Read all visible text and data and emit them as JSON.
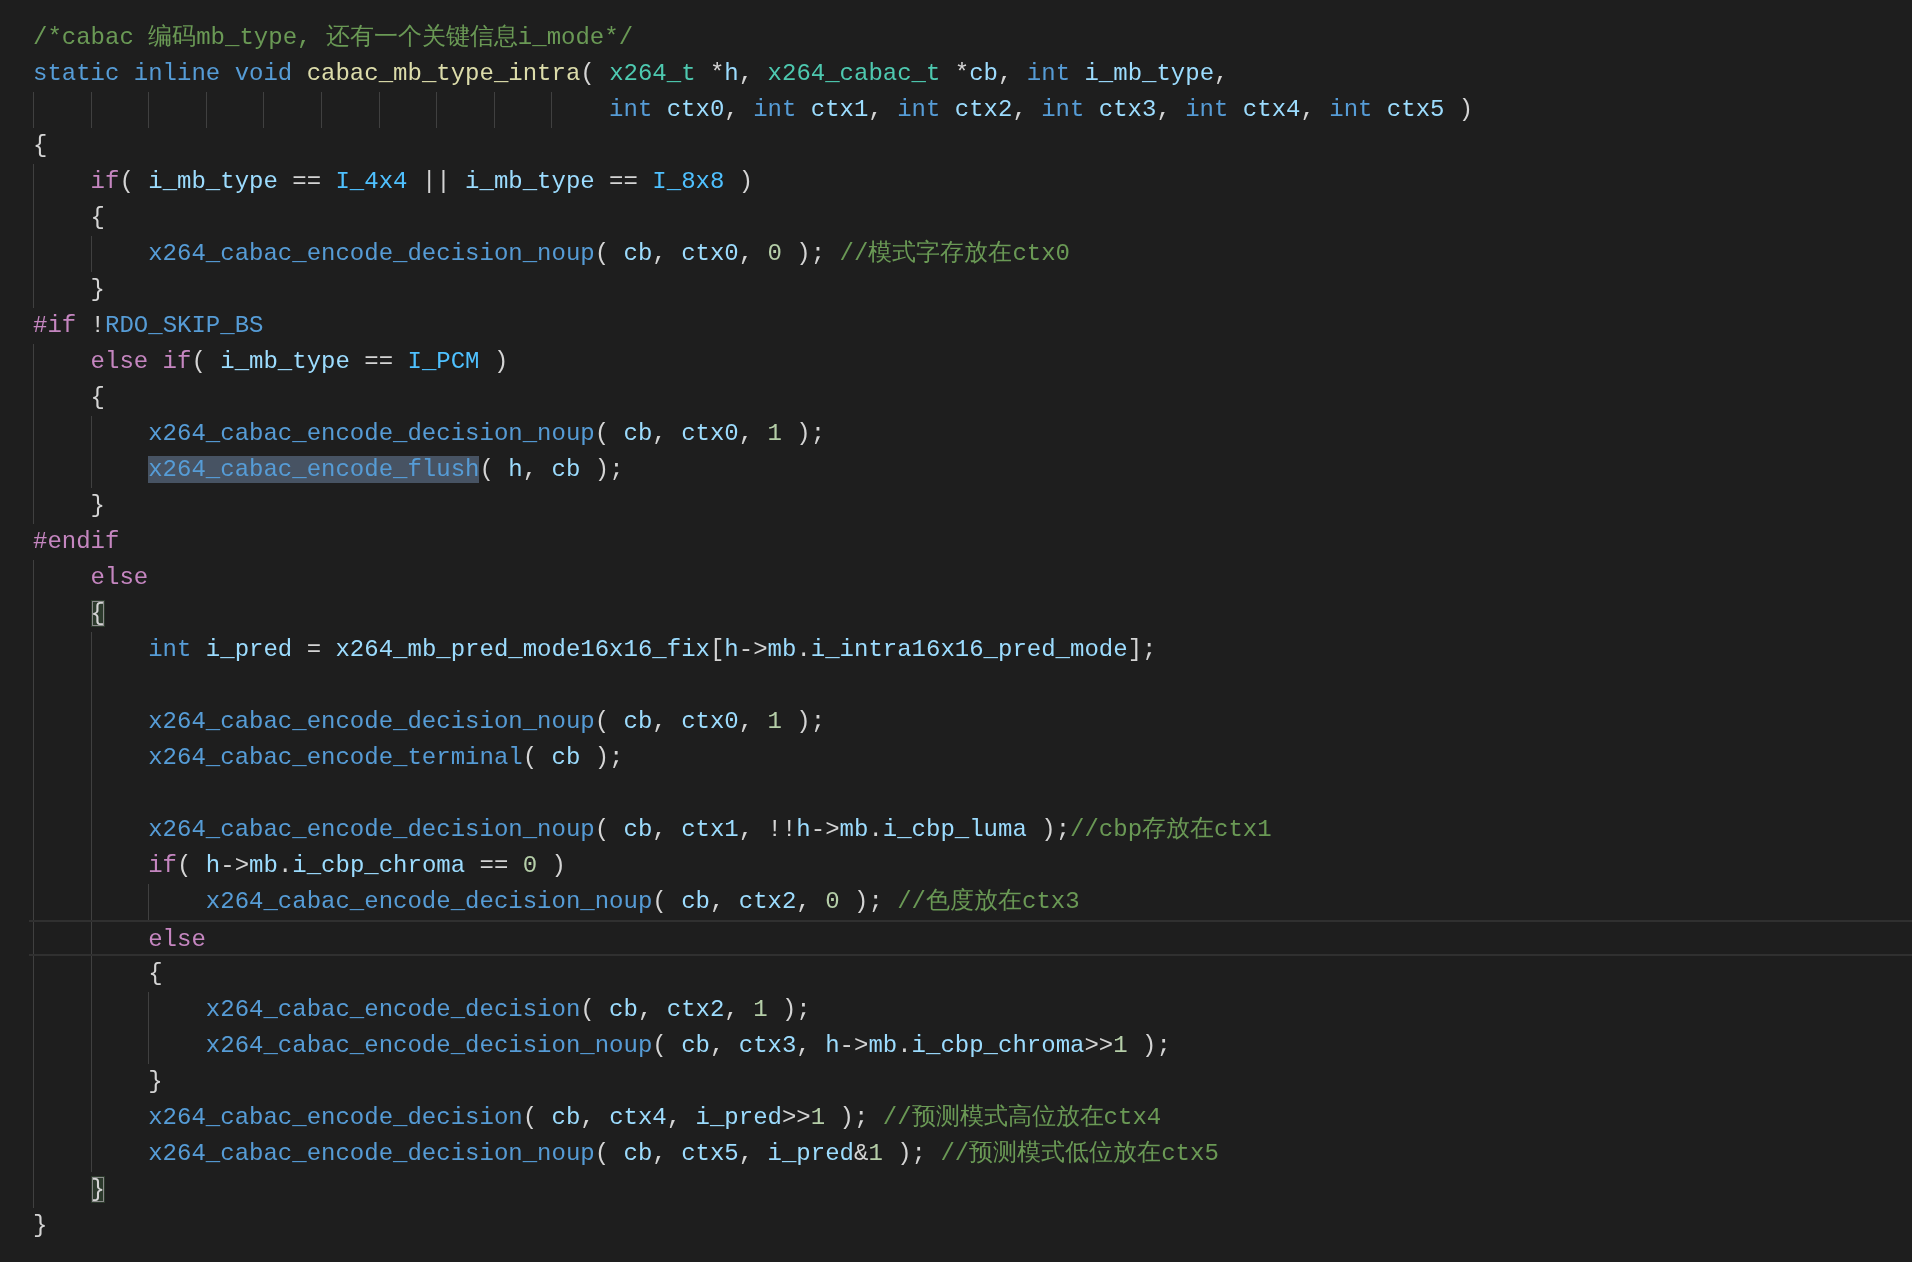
{
  "editor": {
    "lines": [
      {
        "current": false,
        "tokens": [
          {
            "text": "/*cabac 编码mb_type, 还有一个关键信息i_mode*/",
            "kind": "comment"
          }
        ]
      },
      {
        "current": false,
        "tokens": [
          {
            "text": "static inline void ",
            "kind": "keyword"
          },
          {
            "text": "cabac_mb_type_intra",
            "kind": "function"
          },
          {
            "text": "( ",
            "kind": "plain"
          },
          {
            "text": "x264_t",
            "kind": "type"
          },
          {
            "text": " *",
            "kind": "plain"
          },
          {
            "text": "h",
            "kind": "variable"
          },
          {
            "text": ", ",
            "kind": "plain"
          },
          {
            "text": "x264_cabac_t",
            "kind": "type"
          },
          {
            "text": " *",
            "kind": "plain"
          },
          {
            "text": "cb",
            "kind": "variable"
          },
          {
            "text": ", ",
            "kind": "plain"
          },
          {
            "text": "int ",
            "kind": "keyword"
          },
          {
            "text": "i_mb_type",
            "kind": "variable"
          },
          {
            "text": ",",
            "kind": "plain"
          }
        ]
      },
      {
        "current": false,
        "tokens": [
          {
            "text": "                                        int ",
            "kind": "keyword"
          },
          {
            "text": "ctx0",
            "kind": "variable"
          },
          {
            "text": ", ",
            "kind": "plain"
          },
          {
            "text": "int ",
            "kind": "keyword"
          },
          {
            "text": "ctx1",
            "kind": "variable"
          },
          {
            "text": ", ",
            "kind": "plain"
          },
          {
            "text": "int ",
            "kind": "keyword"
          },
          {
            "text": "ctx2",
            "kind": "variable"
          },
          {
            "text": ", ",
            "kind": "plain"
          },
          {
            "text": "int ",
            "kind": "keyword"
          },
          {
            "text": "ctx3",
            "kind": "variable"
          },
          {
            "text": ", ",
            "kind": "plain"
          },
          {
            "text": "int ",
            "kind": "keyword"
          },
          {
            "text": "ctx4",
            "kind": "variable"
          },
          {
            "text": ", ",
            "kind": "plain"
          },
          {
            "text": "int ",
            "kind": "keyword"
          },
          {
            "text": "ctx5",
            "kind": "variable"
          },
          {
            "text": " )",
            "kind": "plain"
          }
        ]
      },
      {
        "current": false,
        "tokens": [
          {
            "text": "{",
            "kind": "plain"
          }
        ]
      },
      {
        "current": false,
        "tokens": [
          {
            "text": "    if",
            "kind": "control"
          },
          {
            "text": "( ",
            "kind": "plain"
          },
          {
            "text": "i_mb_type",
            "kind": "variable"
          },
          {
            "text": " == ",
            "kind": "plain"
          },
          {
            "text": "I_4x4",
            "kind": "constant"
          },
          {
            "text": " || ",
            "kind": "plain"
          },
          {
            "text": "i_mb_type",
            "kind": "variable"
          },
          {
            "text": " == ",
            "kind": "plain"
          },
          {
            "text": "I_8x8",
            "kind": "constant"
          },
          {
            "text": " )",
            "kind": "plain"
          }
        ]
      },
      {
        "current": false,
        "tokens": [
          {
            "text": "    {",
            "kind": "plain"
          }
        ]
      },
      {
        "current": false,
        "tokens": [
          {
            "text": "        x264_cabac_encode_decision_noup",
            "kind": "macro"
          },
          {
            "text": "( ",
            "kind": "plain"
          },
          {
            "text": "cb",
            "kind": "variable"
          },
          {
            "text": ", ",
            "kind": "plain"
          },
          {
            "text": "ctx0",
            "kind": "variable"
          },
          {
            "text": ", ",
            "kind": "plain"
          },
          {
            "text": "0",
            "kind": "number"
          },
          {
            "text": " ); ",
            "kind": "plain"
          },
          {
            "text": "//模式字存放在ctx0",
            "kind": "comment"
          }
        ]
      },
      {
        "current": false,
        "tokens": [
          {
            "text": "    }",
            "kind": "plain"
          }
        ]
      },
      {
        "current": false,
        "tokens": [
          {
            "text": "#if",
            "kind": "control"
          },
          {
            "text": " !",
            "kind": "plain"
          },
          {
            "text": "RDO_SKIP_BS",
            "kind": "macro"
          }
        ]
      },
      {
        "current": false,
        "tokens": [
          {
            "text": "    else if",
            "kind": "control"
          },
          {
            "text": "( ",
            "kind": "plain"
          },
          {
            "text": "i_mb_type",
            "kind": "variable"
          },
          {
            "text": " == ",
            "kind": "plain"
          },
          {
            "text": "I_PCM",
            "kind": "constant"
          },
          {
            "text": " )",
            "kind": "plain"
          }
        ]
      },
      {
        "current": false,
        "tokens": [
          {
            "text": "    {",
            "kind": "plain"
          }
        ]
      },
      {
        "current": false,
        "tokens": [
          {
            "text": "        x264_cabac_encode_decision_noup",
            "kind": "macro"
          },
          {
            "text": "( ",
            "kind": "plain"
          },
          {
            "text": "cb",
            "kind": "variable"
          },
          {
            "text": ", ",
            "kind": "plain"
          },
          {
            "text": "ctx0",
            "kind": "variable"
          },
          {
            "text": ", ",
            "kind": "plain"
          },
          {
            "text": "1",
            "kind": "number"
          },
          {
            "text": " );",
            "kind": "plain"
          }
        ]
      },
      {
        "current": false,
        "tokens": [
          {
            "text": "        x264_cabac_encode_flush",
            "kind": "macro",
            "selected": true
          },
          {
            "text": "( ",
            "kind": "plain"
          },
          {
            "text": "h",
            "kind": "variable"
          },
          {
            "text": ", ",
            "kind": "plain"
          },
          {
            "text": "cb",
            "kind": "variable"
          },
          {
            "text": " );",
            "kind": "plain"
          }
        ]
      },
      {
        "current": false,
        "tokens": [
          {
            "text": "    }",
            "kind": "plain"
          }
        ]
      },
      {
        "current": false,
        "tokens": [
          {
            "text": "#endif",
            "kind": "control"
          }
        ]
      },
      {
        "current": false,
        "tokens": [
          {
            "text": "    else",
            "kind": "control"
          }
        ]
      },
      {
        "current": false,
        "tokens": [
          {
            "text": "    {",
            "kind": "plain",
            "matched": true
          }
        ]
      },
      {
        "current": false,
        "tokens": [
          {
            "text": "        int ",
            "kind": "keyword"
          },
          {
            "text": "i_pred",
            "kind": "variable"
          },
          {
            "text": " = ",
            "kind": "plain"
          },
          {
            "text": "x264_mb_pred_mode16x16_fix",
            "kind": "variable"
          },
          {
            "text": "[",
            "kind": "plain"
          },
          {
            "text": "h",
            "kind": "variable"
          },
          {
            "text": "->",
            "kind": "plain"
          },
          {
            "text": "mb",
            "kind": "variable"
          },
          {
            "text": ".",
            "kind": "plain"
          },
          {
            "text": "i_intra16x16_pred_mode",
            "kind": "variable"
          },
          {
            "text": "];",
            "kind": "plain"
          }
        ]
      },
      {
        "current": false
      },
      {
        "current": false,
        "tokens": [
          {
            "text": "        x264_cabac_encode_decision_noup",
            "kind": "macro"
          },
          {
            "text": "( ",
            "kind": "plain"
          },
          {
            "text": "cb",
            "kind": "variable"
          },
          {
            "text": ", ",
            "kind": "plain"
          },
          {
            "text": "ctx0",
            "kind": "variable"
          },
          {
            "text": ", ",
            "kind": "plain"
          },
          {
            "text": "1",
            "kind": "number"
          },
          {
            "text": " );",
            "kind": "plain"
          }
        ]
      },
      {
        "current": false,
        "tokens": [
          {
            "text": "        x264_cabac_encode_terminal",
            "kind": "macro"
          },
          {
            "text": "( ",
            "kind": "plain"
          },
          {
            "text": "cb",
            "kind": "variable"
          },
          {
            "text": " );",
            "kind": "plain"
          }
        ]
      },
      {
        "current": false
      },
      {
        "current": false,
        "tokens": [
          {
            "text": "        x264_cabac_encode_decision_noup",
            "kind": "macro"
          },
          {
            "text": "( ",
            "kind": "plain"
          },
          {
            "text": "cb",
            "kind": "variable"
          },
          {
            "text": ", ",
            "kind": "plain"
          },
          {
            "text": "ctx1",
            "kind": "variable"
          },
          {
            "text": ", !!",
            "kind": "plain"
          },
          {
            "text": "h",
            "kind": "variable"
          },
          {
            "text": "->",
            "kind": "plain"
          },
          {
            "text": "mb",
            "kind": "variable"
          },
          {
            "text": ".",
            "kind": "plain"
          },
          {
            "text": "i_cbp_luma",
            "kind": "variable"
          },
          {
            "text": " );",
            "kind": "plain"
          },
          {
            "text": "//cbp存放在ctx1",
            "kind": "comment"
          }
        ]
      },
      {
        "current": false,
        "tokens": [
          {
            "text": "        if",
            "kind": "control"
          },
          {
            "text": "( ",
            "kind": "plain"
          },
          {
            "text": "h",
            "kind": "variable"
          },
          {
            "text": "->",
            "kind": "plain"
          },
          {
            "text": "mb",
            "kind": "variable"
          },
          {
            "text": ".",
            "kind": "plain"
          },
          {
            "text": "i_cbp_chroma",
            "kind": "variable"
          },
          {
            "text": " == ",
            "kind": "plain"
          },
          {
            "text": "0",
            "kind": "number"
          },
          {
            "text": " )",
            "kind": "plain"
          }
        ]
      },
      {
        "current": false,
        "tokens": [
          {
            "text": "            x264_cabac_encode_decision_noup",
            "kind": "macro"
          },
          {
            "text": "( ",
            "kind": "plain"
          },
          {
            "text": "cb",
            "kind": "variable"
          },
          {
            "text": ", ",
            "kind": "plain"
          },
          {
            "text": "ctx2",
            "kind": "variable"
          },
          {
            "text": ", ",
            "kind": "plain"
          },
          {
            "text": "0",
            "kind": "number"
          },
          {
            "text": " ); ",
            "kind": "plain"
          },
          {
            "text": "//色度放在ctx3",
            "kind": "comment"
          }
        ]
      },
      {
        "current": true,
        "tokens": [
          {
            "text": "        else",
            "kind": "control"
          }
        ]
      },
      {
        "current": false,
        "tokens": [
          {
            "text": "        {",
            "kind": "plain"
          }
        ]
      },
      {
        "current": false,
        "tokens": [
          {
            "text": "            x264_cabac_encode_decision",
            "kind": "macro"
          },
          {
            "text": "( ",
            "kind": "plain"
          },
          {
            "text": "cb",
            "kind": "variable"
          },
          {
            "text": ", ",
            "kind": "plain"
          },
          {
            "text": "ctx2",
            "kind": "variable"
          },
          {
            "text": ", ",
            "kind": "plain"
          },
          {
            "text": "1",
            "kind": "number"
          },
          {
            "text": " );",
            "kind": "plain"
          }
        ]
      },
      {
        "current": false,
        "tokens": [
          {
            "text": "            x264_cabac_encode_decision_noup",
            "kind": "macro"
          },
          {
            "text": "( ",
            "kind": "plain"
          },
          {
            "text": "cb",
            "kind": "variable"
          },
          {
            "text": ", ",
            "kind": "plain"
          },
          {
            "text": "ctx3",
            "kind": "variable"
          },
          {
            "text": ", ",
            "kind": "plain"
          },
          {
            "text": "h",
            "kind": "variable"
          },
          {
            "text": "->",
            "kind": "plain"
          },
          {
            "text": "mb",
            "kind": "variable"
          },
          {
            "text": ".",
            "kind": "plain"
          },
          {
            "text": "i_cbp_chroma",
            "kind": "variable"
          },
          {
            "text": ">>",
            "kind": "plain"
          },
          {
            "text": "1",
            "kind": "number"
          },
          {
            "text": " );",
            "kind": "plain"
          }
        ]
      },
      {
        "current": false,
        "tokens": [
          {
            "text": "        }",
            "kind": "plain"
          }
        ]
      },
      {
        "current": false,
        "tokens": [
          {
            "text": "        x264_cabac_encode_decision",
            "kind": "macro"
          },
          {
            "text": "( ",
            "kind": "plain"
          },
          {
            "text": "cb",
            "kind": "variable"
          },
          {
            "text": ", ",
            "kind": "plain"
          },
          {
            "text": "ctx4",
            "kind": "variable"
          },
          {
            "text": ", ",
            "kind": "plain"
          },
          {
            "text": "i_pred",
            "kind": "variable"
          },
          {
            "text": ">>",
            "kind": "plain"
          },
          {
            "text": "1",
            "kind": "number"
          },
          {
            "text": " ); ",
            "kind": "plain"
          },
          {
            "text": "//预测模式高位放在ctx4",
            "kind": "comment"
          }
        ]
      },
      {
        "current": false,
        "tokens": [
          {
            "text": "        x264_cabac_encode_decision_noup",
            "kind": "macro"
          },
          {
            "text": "( ",
            "kind": "plain"
          },
          {
            "text": "cb",
            "kind": "variable"
          },
          {
            "text": ", ",
            "kind": "plain"
          },
          {
            "text": "ctx5",
            "kind": "variable"
          },
          {
            "text": ", ",
            "kind": "plain"
          },
          {
            "text": "i_pred",
            "kind": "variable"
          },
          {
            "text": "&",
            "kind": "plain"
          },
          {
            "text": "1",
            "kind": "number"
          },
          {
            "text": " ); ",
            "kind": "plain"
          },
          {
            "text": "//预测模式低位放在ctx5",
            "kind": "comment"
          }
        ]
      },
      {
        "current": false,
        "tokens": [
          {
            "text": "    }",
            "kind": "plain",
            "matched": true
          }
        ]
      },
      {
        "current": false,
        "tokens": [
          {
            "text": "}",
            "kind": "plain"
          }
        ]
      }
    ]
  }
}
